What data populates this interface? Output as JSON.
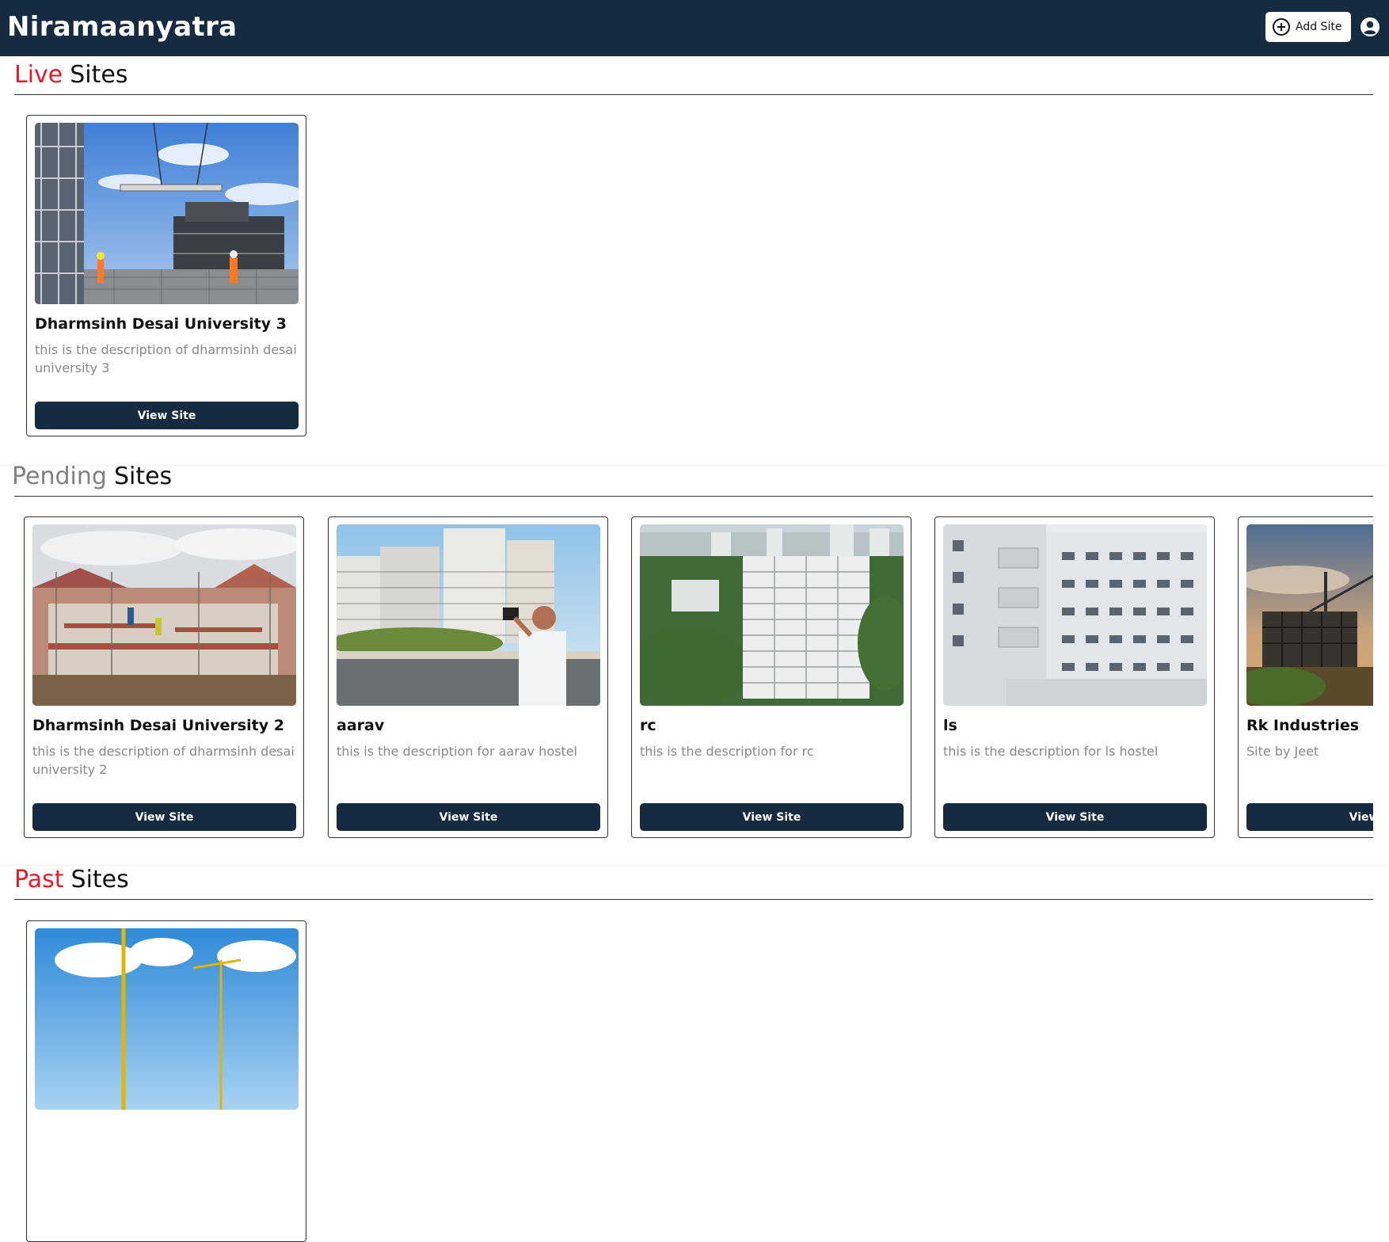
{
  "header": {
    "brand": "Niramaanyatra",
    "add_site_label": "Add Site"
  },
  "sections": {
    "live": {
      "accent": "Live",
      "rest": "Sites",
      "accent_color": "#e11d2a"
    },
    "pending": {
      "accent": "Pending",
      "rest": "Sites",
      "accent_color": "#808080"
    },
    "past": {
      "accent": "Past",
      "rest": "Sites",
      "accent_color": "#e11d2a"
    }
  },
  "live_sites": [
    {
      "title": "Dharmsinh Desai University 3",
      "description": "this is the description of dharmsinh desai university 3",
      "button": "View Site"
    }
  ],
  "pending_sites": [
    {
      "title": "Dharmsinh Desai University 2",
      "description": "this is the description of dharmsinh desai university 2",
      "button": "View Site"
    },
    {
      "title": "aarav",
      "description": "this is the description for aarav hostel",
      "button": "View Site"
    },
    {
      "title": "rc",
      "description": "this is the description for rc",
      "button": "View Site"
    },
    {
      "title": "ls",
      "description": "this is the description for ls hostel",
      "button": "View Site"
    },
    {
      "title": "Rk Industries",
      "description": "Site by Jeet",
      "button": "View Site"
    }
  ],
  "colors": {
    "navbar": "#162a40",
    "button": "#162a40"
  }
}
